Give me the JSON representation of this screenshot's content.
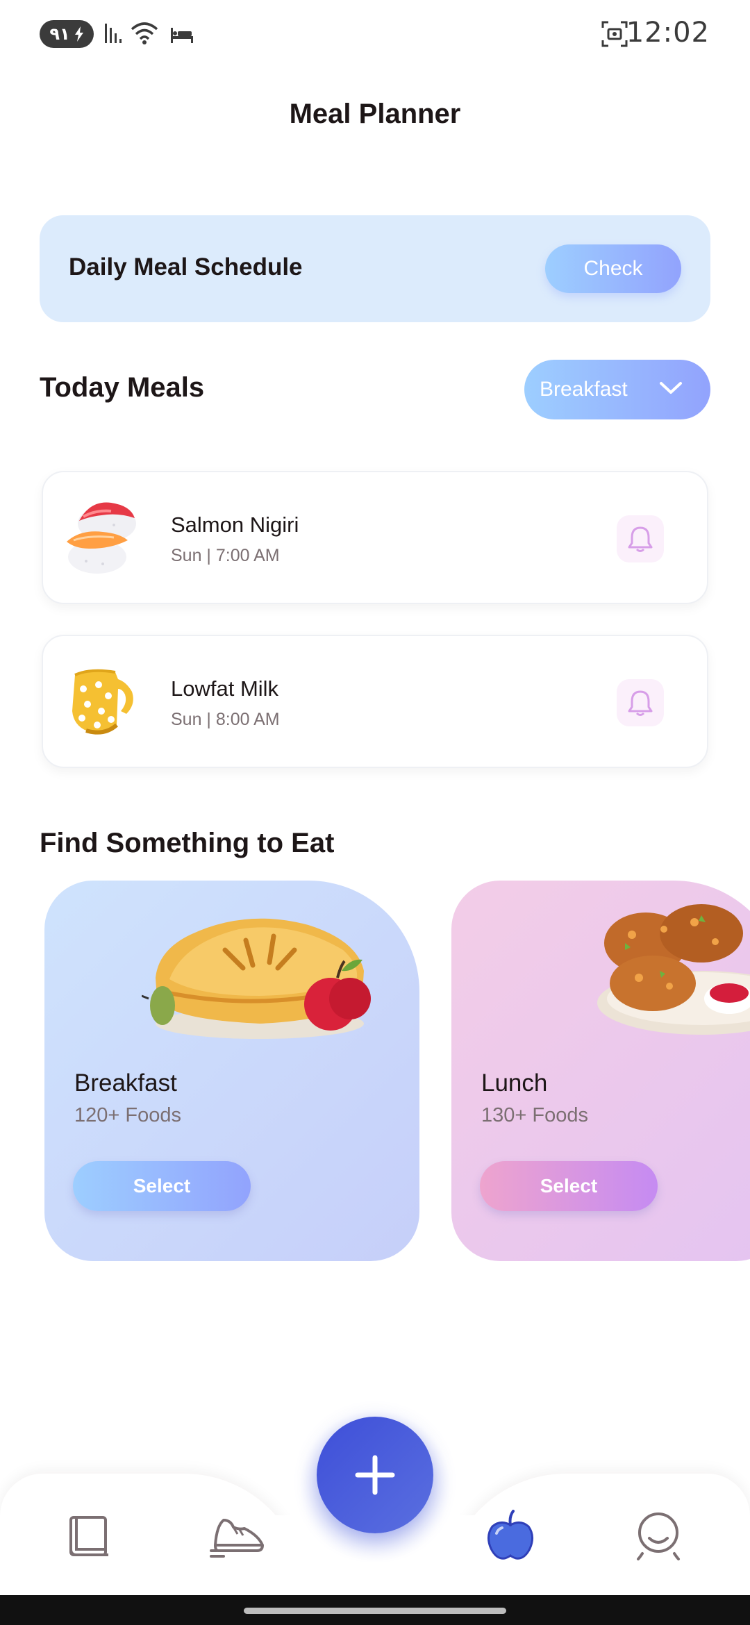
{
  "status_bar": {
    "battery": "٩١",
    "time": "12:02",
    "icons": [
      "charging-icon",
      "signal-icon",
      "wifi-icon",
      "sleep-icon",
      "screenshot-icon"
    ]
  },
  "header": {
    "title": "Meal Planner"
  },
  "schedule": {
    "title": "Daily Meal Schedule",
    "button": "Check"
  },
  "today": {
    "title": "Today Meals",
    "dropdown_value": "Breakfast",
    "meals": [
      {
        "name": "Salmon Nigiri",
        "time": "Sun | 7:00 AM",
        "icon": "sushi-icon"
      },
      {
        "name": "Lowfat Milk",
        "time": "Sun | 8:00 AM",
        "icon": "milk-jug-icon"
      }
    ]
  },
  "find": {
    "title": "Find Something to Eat",
    "cards": [
      {
        "title": "Breakfast",
        "count": "120+ Foods",
        "button": "Select",
        "icon": "pie-icon"
      },
      {
        "title": "Lunch",
        "count": "130+ Foods",
        "button": "Select",
        "icon": "chicken-plate-icon"
      }
    ]
  },
  "bottom_nav": {
    "items": [
      "book-icon",
      "shoe-icon",
      "add-icon",
      "apple-icon",
      "profile-icon"
    ],
    "active": "apple-icon"
  },
  "colors": {
    "accent_blue": "#92a3fd",
    "accent_light_blue": "#9dceff",
    "accent_pink": "#eea4ce",
    "accent_purple": "#c58bf2",
    "fab": "#4556db",
    "text": "#1d1617",
    "muted": "#7b6f72"
  }
}
